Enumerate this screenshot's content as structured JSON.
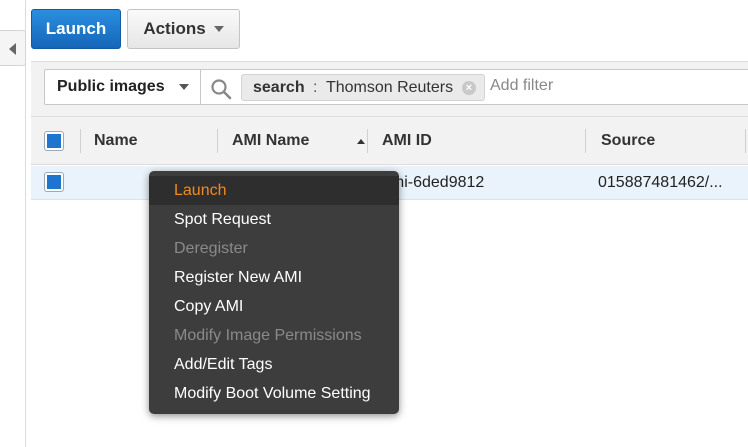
{
  "toolbar": {
    "launch_label": "Launch",
    "actions_label": "Actions"
  },
  "filter": {
    "scope_label": "Public images",
    "token_key": "search",
    "token_sep": " : ",
    "token_value": "Thomson Reuters",
    "add_filter_placeholder": "Add filter"
  },
  "table": {
    "columns": [
      {
        "label": "Name"
      },
      {
        "label": "AMI Name",
        "sorted": "asc"
      },
      {
        "label": "AMI ID"
      },
      {
        "label": "Source"
      }
    ],
    "rows": [
      {
        "name": "",
        "ami_name": "",
        "ami_id": "ami-6ded9812",
        "source": "015887481462/..."
      }
    ]
  },
  "context_menu": {
    "items": [
      {
        "label": "Launch",
        "state": "active"
      },
      {
        "label": "Spot Request",
        "state": "enabled"
      },
      {
        "label": "Deregister",
        "state": "disabled"
      },
      {
        "label": "Register New AMI",
        "state": "enabled"
      },
      {
        "label": "Copy AMI",
        "state": "enabled"
      },
      {
        "label": "Modify Image Permissions",
        "state": "disabled"
      },
      {
        "label": "Add/Edit Tags",
        "state": "enabled"
      },
      {
        "label": "Modify Boot Volume Setting",
        "state": "enabled"
      }
    ]
  },
  "colors": {
    "primary": "#1f74cf",
    "menu_bg": "#3d3d3d",
    "menu_active": "#f08a24",
    "row_selected": "#eaf3fc"
  },
  "icons": {
    "collapse": "chevron-left-icon",
    "search": "search-icon",
    "token_remove": "close-circle-icon",
    "dropdown": "chevron-down-icon",
    "sort": "sort-ascending-icon"
  }
}
